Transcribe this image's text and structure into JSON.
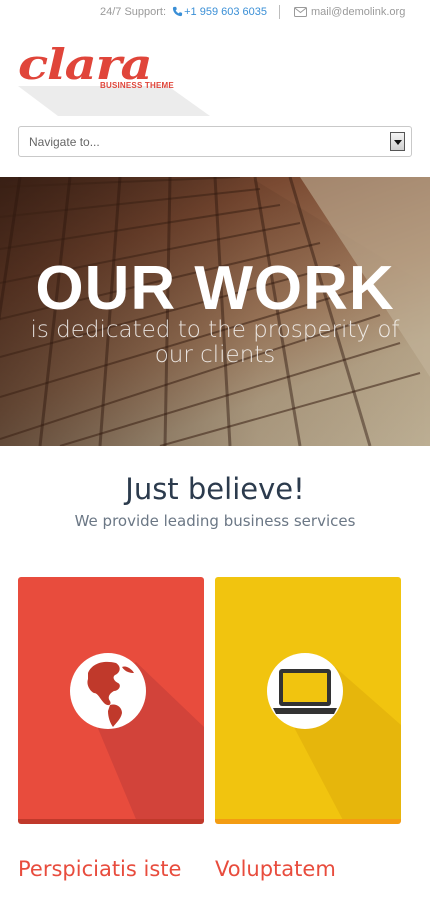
{
  "topbar": {
    "support_label": "24/7 Support:",
    "phone": "+1 959 603 6035",
    "email": "mail@demolink.org"
  },
  "logo": {
    "wordmark": "clara",
    "tagline": "BUSINESS THEME"
  },
  "nav": {
    "select_value": "Navigate to..."
  },
  "hero": {
    "title": "OUR WORK",
    "subtitle_line1": "is dedicated to the prosperity of",
    "subtitle_line2": "our clients"
  },
  "intro": {
    "title": "Just believe!",
    "subtitle": "We provide leading business services"
  },
  "cards": [
    {
      "label": "Perspiciatis iste",
      "icon": "globe-icon",
      "color": "#e84c3d"
    },
    {
      "label": "Voluptatem",
      "icon": "laptop-icon",
      "color": "#f1c40f"
    }
  ],
  "colors": {
    "accent": "#e84c3d",
    "link": "#3a8fd6",
    "heading": "#2c3b4d"
  }
}
